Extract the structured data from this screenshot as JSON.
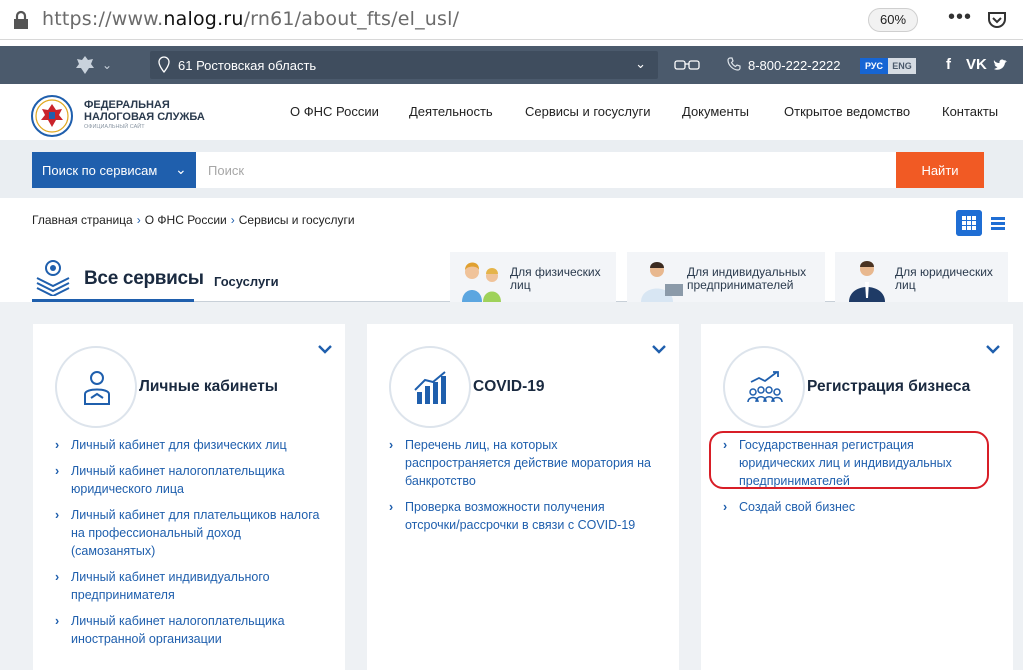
{
  "browser": {
    "url_prefix": "https://www.",
    "url_domain": "nalog.ru",
    "url_path": "/rn61/about_fts/el_usl/",
    "zoom": "60%",
    "menu": "•••"
  },
  "topbar": {
    "region": "61 Ростовская область",
    "phone": "8-800-222-2222",
    "lang_active": "РУС",
    "lang_other": "ENG",
    "social": [
      "f",
      "VK",
      "tw"
    ]
  },
  "logo": {
    "line1": "ФЕДЕРАЛЬНАЯ",
    "line2": "НАЛОГОВАЯ СЛУЖБА",
    "sub": "ОФИЦИАЛЬНЫЙ САЙТ"
  },
  "nav": [
    "О ФНС России",
    "Деятельность",
    "Сервисы и госуслуги",
    "Документы",
    "Открытое ведомство",
    "Контакты"
  ],
  "search": {
    "scope": "Поиск по сервисам",
    "placeholder": "Поиск",
    "button": "Найти"
  },
  "breadcrumb": [
    "Главная страница",
    "О ФНС России",
    "Сервисы и госуслуги"
  ],
  "services": {
    "all_label": "Все сервисы",
    "gos_label": "Госуслуги",
    "audiences": [
      {
        "line1": "Для физических",
        "line2": "лиц"
      },
      {
        "line1": "Для индивидуальных",
        "line2": "предпринимателей"
      },
      {
        "line1": "Для юридических",
        "line2": "лиц"
      }
    ]
  },
  "cards": [
    {
      "title": "Личные кабинеты",
      "links": [
        "Личный кабинет для физических лиц",
        "Личный кабинет налогоплательщика юридического лица",
        "Личный кабинет для плательщиков налога на профессиональный доход (самозанятых)",
        "Личный кабинет индивидуального предпринимателя",
        "Личный кабинет налогоплательщика иностранной организации"
      ]
    },
    {
      "title": "COVID-19",
      "links": [
        "Перечень лиц, на которых распространяется действие моратория на банкротство",
        "Проверка возможности получения отсрочки/рассрочки в связи с COVID-19"
      ]
    },
    {
      "title": "Регистрация бизнеса",
      "links": [
        "Государственная регистрация юридических лиц и индивидуальных предпринимателей",
        "Создай свой бизнес"
      ]
    }
  ],
  "colors": {
    "accent": "#1f5fad",
    "topbar": "#4b5a6c",
    "search_button": "#f15a24",
    "highlight": "#d81e27"
  }
}
